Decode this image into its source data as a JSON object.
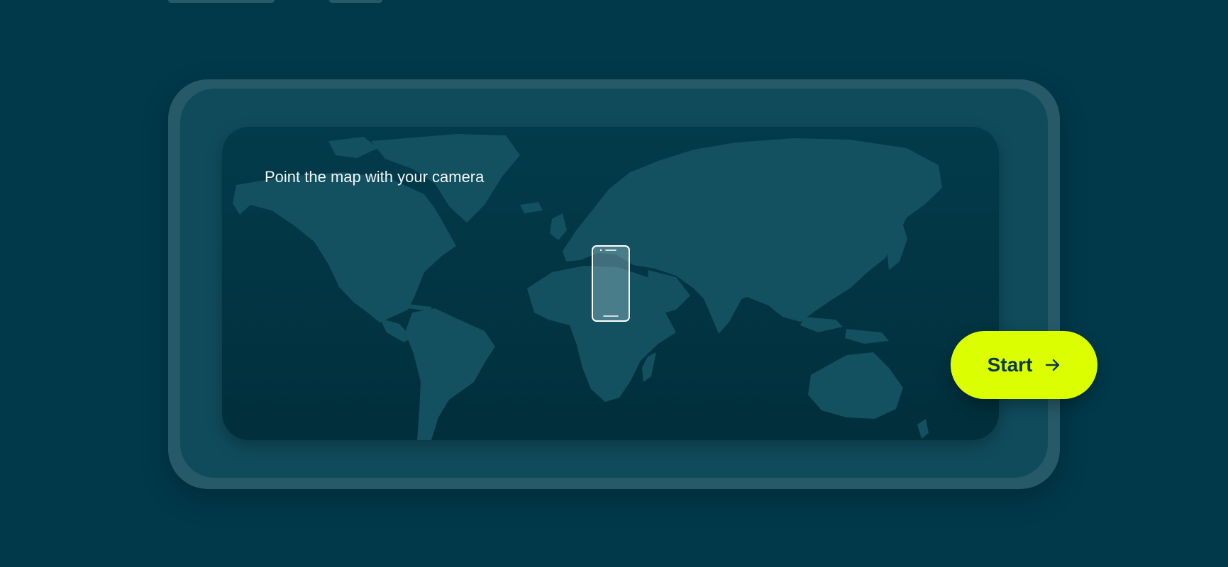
{
  "instruction": {
    "text": "Point the map with your camera"
  },
  "start_button": {
    "label": "Start",
    "icon": "arrow-right-icon"
  },
  "colors": {
    "background": "#01394a",
    "device_frame": "#265a68",
    "device_bezel": "#104b5c",
    "map_land": "#135060",
    "accent": "#dcff00"
  }
}
